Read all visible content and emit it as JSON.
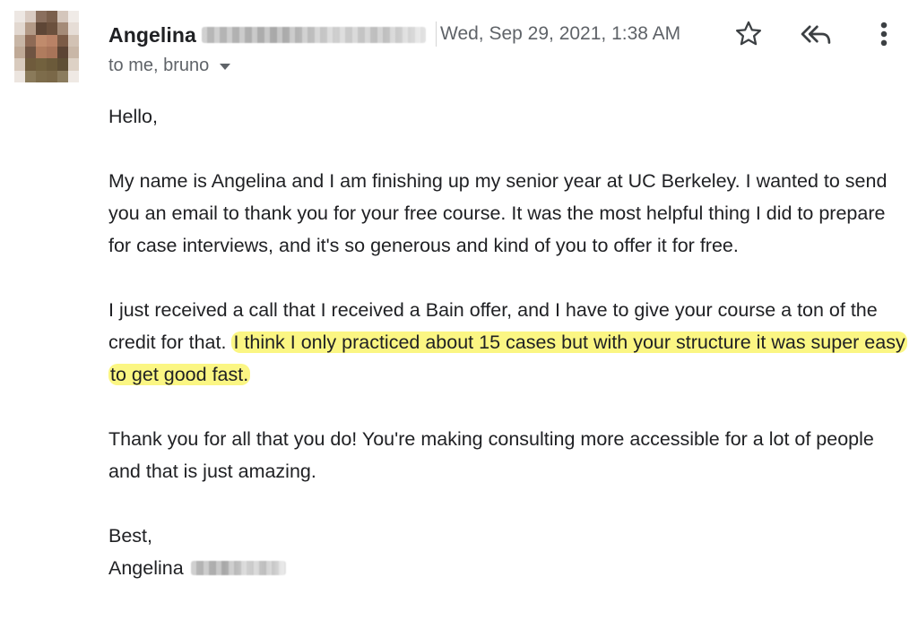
{
  "sender": {
    "name": "Angelina",
    "date": "Wed, Sep 29, 2021, 1:38 AM",
    "recipients": "to me, bruno"
  },
  "actions": {
    "star_icon": "star-icon",
    "reply_icon": "reply-all-icon",
    "more_icon": "more-vertical-icon"
  },
  "message": {
    "greeting": "Hello,",
    "p1": "My name is Angelina and I am finishing up my senior year at UC Berkeley. I wanted to send you an email to thank you for your free course. It was the most helpful thing I did to prepare for case interviews, and it's so generous and kind of you to offer it for free.",
    "p2_plain": "I just received a call that I received a Bain offer, and I have to give your course a ton of the credit for that.",
    "p2_highlight": "I think I only practiced about 15 cases but with your structure it was super easy to get good fast.",
    "p3": "Thank you for all that you do! You're making consulting more accessible for a lot of people and that is just amazing.",
    "closing": "Best,",
    "signature_name": "Angelina"
  },
  "colors": {
    "highlight": "#fbf683",
    "text": "#202124",
    "secondary_text": "#5f6368"
  }
}
